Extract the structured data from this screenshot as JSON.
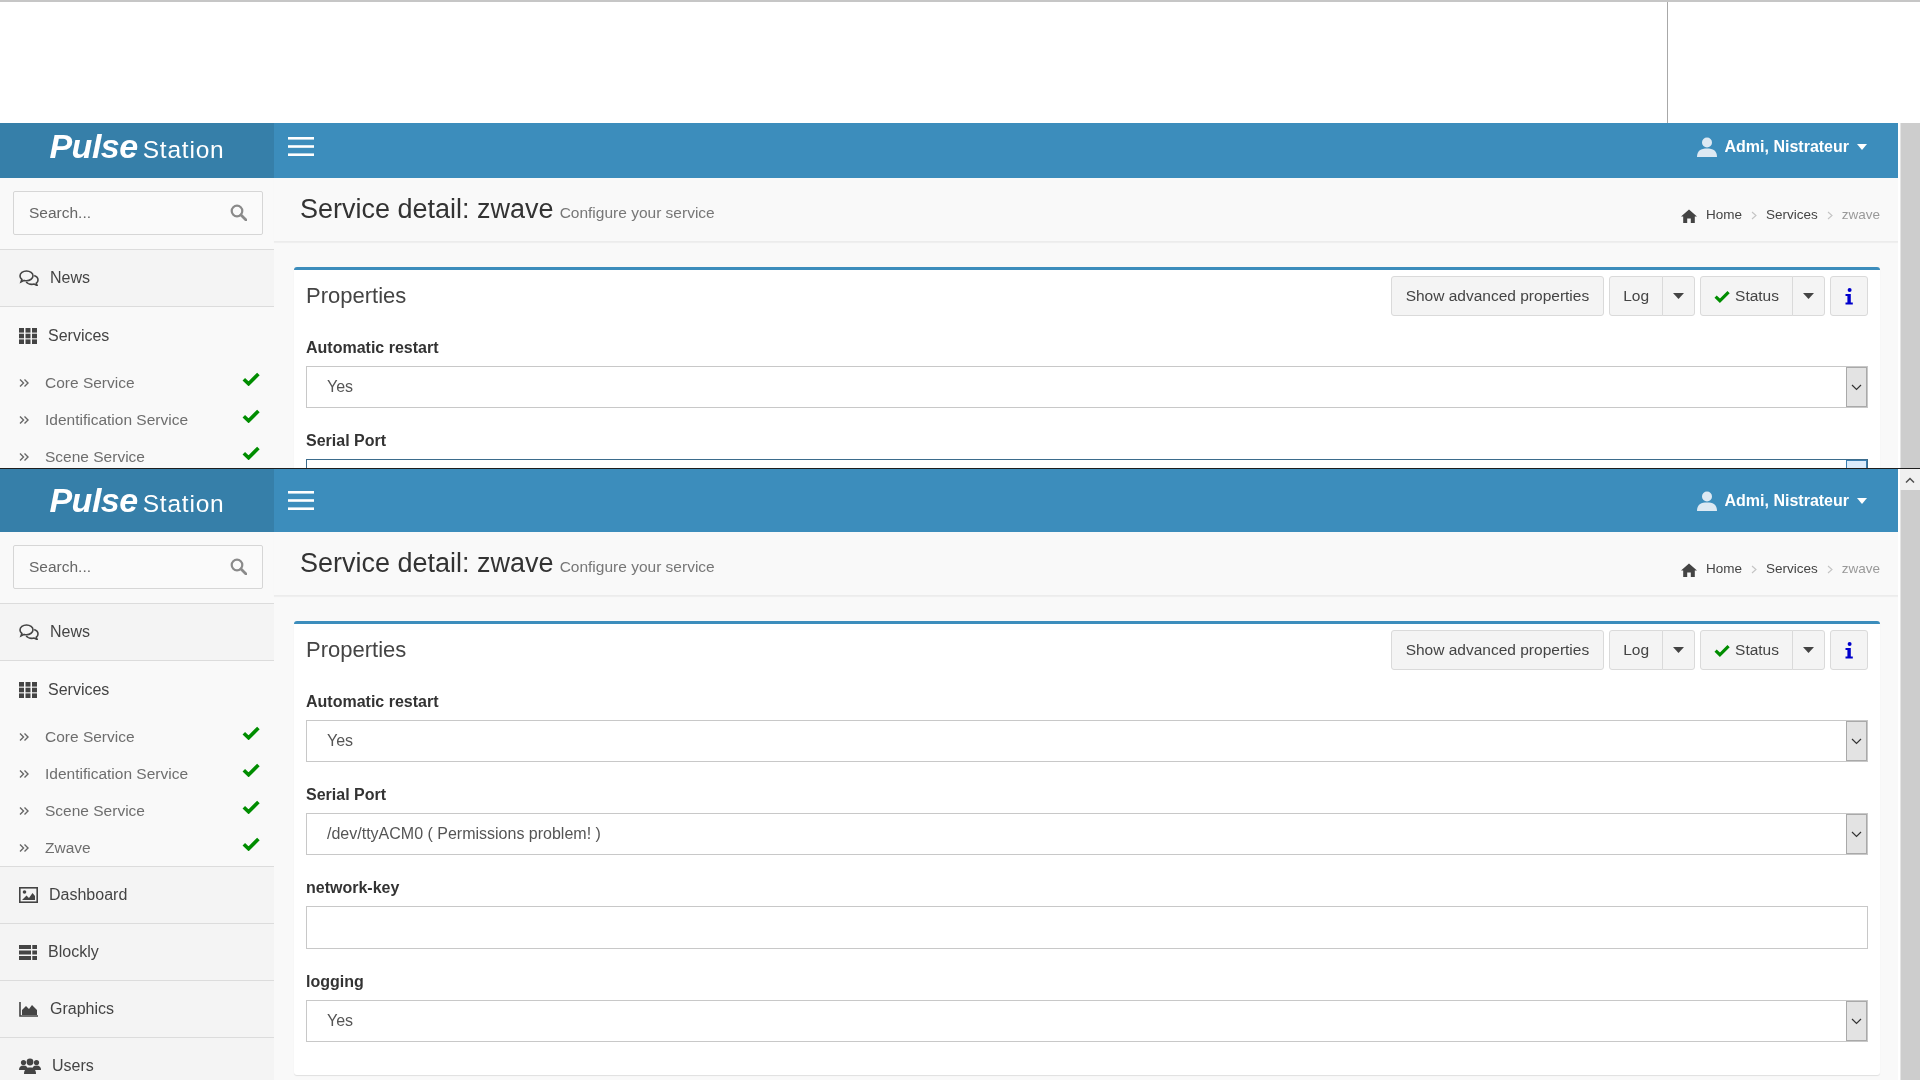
{
  "screens": [
    {
      "cut_off": true,
      "navbar": {
        "brand": "Pulse",
        "brand_suffix": "Station",
        "user": "Admi, Nistrateur"
      },
      "sidebar": {
        "search": {
          "placeholder": "Search..."
        },
        "items": [
          {
            "label": "News",
            "expanded": false
          },
          {
            "label": "Services",
            "expanded": true,
            "children": [
              {
                "label": "Core Service",
                "ok": true
              },
              {
                "label": "Identification Service",
                "ok": true
              },
              {
                "label": "Scene Service",
                "ok": true
              }
            ]
          }
        ]
      },
      "content": {
        "title": "Service detail: zwave",
        "subtitle": "Configure your service",
        "breadcrumb": [
          "Home",
          "Services",
          "zwave"
        ],
        "card": {
          "title": "Properties",
          "buttons": [
            {
              "kind": "plain",
              "label": "Show advanced properties"
            },
            {
              "kind": "split",
              "label": "Log"
            },
            {
              "kind": "split",
              "label": "Status",
              "ok": true
            },
            {
              "kind": "info"
            }
          ],
          "fields": [
            {
              "label": "Automatic restart",
              "kind": "select",
              "value": "Yes",
              "focused": false
            },
            {
              "label": "Serial Port",
              "kind": "select",
              "focused": true
            }
          ]
        }
      }
    },
    {
      "cut_off": false,
      "navbar": {
        "brand": "Pulse",
        "brand_suffix": "Station",
        "user": "Admi, Nistrateur"
      },
      "sidebar": {
        "search": {
          "placeholder": "Search..."
        },
        "items": [
          {
            "label": "News",
            "expanded": false
          },
          {
            "label": "Services",
            "expanded": true,
            "children": [
              {
                "label": "Core Service",
                "ok": true
              },
              {
                "label": "Identification Service",
                "ok": true
              },
              {
                "label": "Scene Service",
                "ok": true
              },
              {
                "label": "Zwave",
                "ok": true
              }
            ]
          },
          {
            "label": "Dashboard",
            "expanded": false
          },
          {
            "label": "Blockly",
            "expanded": false
          },
          {
            "label": "Graphics",
            "expanded": false
          },
          {
            "label": "Users",
            "expanded": false
          }
        ]
      },
      "content": {
        "title": "Service detail: zwave",
        "subtitle": "Configure your service",
        "breadcrumb": [
          "Home",
          "Services",
          "zwave"
        ],
        "card": {
          "title": "Properties",
          "buttons": [
            {
              "kind": "plain",
              "label": "Show advanced properties"
            },
            {
              "kind": "split",
              "label": "Log"
            },
            {
              "kind": "split",
              "label": "Status",
              "ok": true
            },
            {
              "kind": "info"
            }
          ],
          "fields": [
            {
              "label": "Automatic restart",
              "kind": "select",
              "value": "Yes",
              "focused": false
            },
            {
              "label": "Serial Port",
              "kind": "select",
              "value": "/dev/ttyACM0 ( Permissions problem! )",
              "focused": false
            },
            {
              "label": "network-key",
              "kind": "text",
              "focused": false
            },
            {
              "label": "logging",
              "kind": "select",
              "value": "Yes",
              "focused": false
            }
          ]
        }
      }
    }
  ]
}
